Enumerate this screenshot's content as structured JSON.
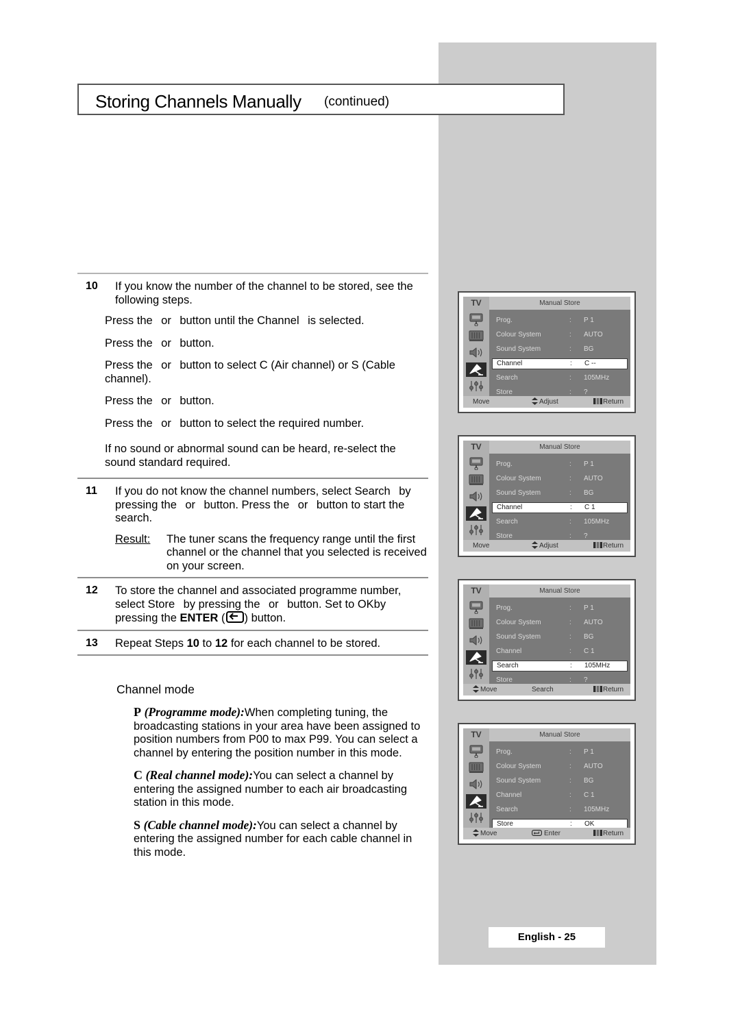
{
  "header": {
    "title": "Storing Channels Manually",
    "continued": "(continued)"
  },
  "steps": [
    {
      "number": "10",
      "body": "If you know the number of the channel to be stored, see the following steps.",
      "sub_items": [
        "Press the   or   button until the Channel   is selected.",
        "Press the   or   button.",
        "Press the   or   button to select C (Air channel) or S (Cable channel).",
        "Press the   or   button.",
        "Press the   or   button to select the required number."
      ],
      "note": "If no sound or abnormal sound can be heard, re-select the sound standard required."
    },
    {
      "number": "11",
      "body": "If you do not know the channel numbers, select Search   by pressing the   or   button. Press the   or   button to start the search.",
      "result_label": "Result:",
      "result_text": "The tuner scans the frequency range until the first channel or the channel that you selected is received on your screen."
    },
    {
      "number": "12",
      "body_pre": "To store the channel and associated programme number, select Store   by pressing the   or   button. Set to OKby pressing the ",
      "enter_label": "ENTER",
      "body_post": ") button."
    },
    {
      "number": "13",
      "body_pre": "Repeat Steps ",
      "bold_a": "10",
      "body_mid": " to ",
      "bold_b": "12",
      "body_post": " for each channel to be stored."
    }
  ],
  "channel_mode": {
    "title": "Channel mode",
    "modes": [
      {
        "letter": "P",
        "name": "(Programme mode):",
        "text": "When completing tuning, the broadcasting stations in your area have been assigned to position numbers from P00 to max P99. You can select a channel by entering the position number in this mode."
      },
      {
        "letter": "C",
        "name": "(Real channel mode):",
        "text": "You can select a channel by entering the assigned number to each air broadcasting station in this mode."
      },
      {
        "letter": "S",
        "name": "(Cable channel mode):",
        "text": "You can select a channel by entering the assigned number for each cable channel in this mode."
      }
    ]
  },
  "osd_common": {
    "tv_label": "TV",
    "menu_title": "Manual Store",
    "colon": ":",
    "icons": [
      "picture-source-icon",
      "picture-bars-icon",
      "speaker-icon",
      "satellite-dish-icon",
      "sliders-icon"
    ]
  },
  "osd_panels": [
    {
      "rows": [
        {
          "label": "Prog.",
          "value": "P 1",
          "highlight": false
        },
        {
          "label": "Colour System",
          "value": "AUTO",
          "highlight": false
        },
        {
          "label": "Sound System",
          "value": "BG",
          "highlight": false
        },
        {
          "label": "Channel",
          "value": "C --",
          "highlight": true
        },
        {
          "label": "Search",
          "value": "105MHz",
          "highlight": false
        },
        {
          "label": "Store",
          "value": "?",
          "highlight": false
        }
      ],
      "footer": {
        "move": "Move",
        "middle": "Adjust",
        "return": "Return",
        "move_icon": false,
        "middle_icon": "updown"
      }
    },
    {
      "rows": [
        {
          "label": "Prog.",
          "value": "P 1",
          "highlight": false
        },
        {
          "label": "Colour System",
          "value": "AUTO",
          "highlight": false
        },
        {
          "label": "Sound System",
          "value": "BG",
          "highlight": false
        },
        {
          "label": "Channel",
          "value": "C  1",
          "highlight": true
        },
        {
          "label": "Search",
          "value": "105MHz",
          "highlight": false
        },
        {
          "label": "Store",
          "value": "?",
          "highlight": false
        }
      ],
      "footer": {
        "move": "Move",
        "middle": "Adjust",
        "return": "Return",
        "move_icon": false,
        "middle_icon": "updown"
      }
    },
    {
      "rows": [
        {
          "label": "Prog.",
          "value": "P 1",
          "highlight": false
        },
        {
          "label": "Colour System",
          "value": "AUTO",
          "highlight": false
        },
        {
          "label": "Sound System",
          "value": "BG",
          "highlight": false
        },
        {
          "label": "Channel",
          "value": "C  1",
          "highlight": false
        },
        {
          "label": "Search",
          "value": "105MHz",
          "highlight": true
        },
        {
          "label": "Store",
          "value": "?",
          "highlight": false
        }
      ],
      "footer": {
        "move": "Move",
        "middle": "Search",
        "return": "Return",
        "move_icon": "updown",
        "middle_icon": false
      }
    },
    {
      "rows": [
        {
          "label": "Prog.",
          "value": "P 1",
          "highlight": false
        },
        {
          "label": "Colour System",
          "value": "AUTO",
          "highlight": false
        },
        {
          "label": "Sound System",
          "value": "BG",
          "highlight": false
        },
        {
          "label": "Channel",
          "value": "C  1",
          "highlight": false
        },
        {
          "label": "Search",
          "value": "105MHz",
          "highlight": false
        },
        {
          "label": "Store",
          "value": "OK",
          "highlight": true
        }
      ],
      "footer": {
        "move": "Move",
        "middle": "Enter",
        "return": "Return",
        "move_icon": "updown",
        "middle_icon": "enter"
      }
    }
  ],
  "footer": {
    "page_label": "English - 25"
  }
}
